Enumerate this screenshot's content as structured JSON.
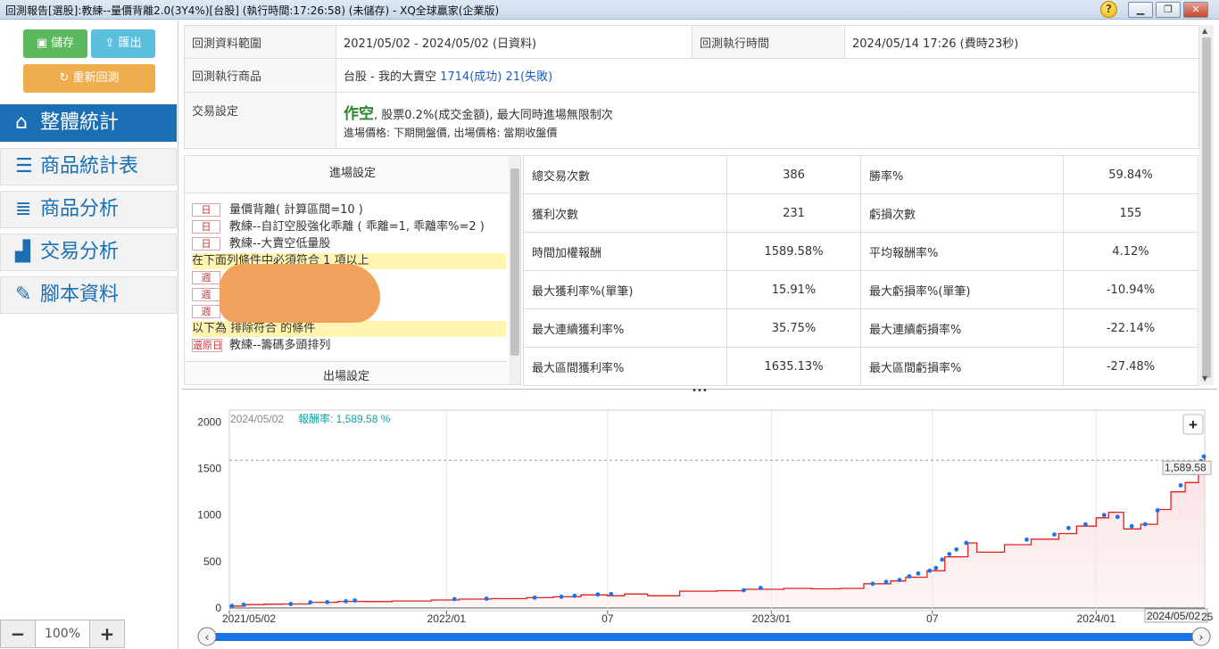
{
  "window": {
    "title": "回測報告[選股]:教練--量價背離2.0(3Y4%)[台股] (執行時間:17:26:58) (未儲存) - XQ全球贏家(企業版)",
    "help": "?",
    "min": "▁",
    "max": "❐",
    "close": "✕"
  },
  "toolbar": {
    "save": "儲存",
    "export": "匯出",
    "rerun": "重新回測"
  },
  "nav": [
    {
      "label": "整體統計",
      "icon": "home-icon"
    },
    {
      "label": "商品統計表",
      "icon": "list-icon"
    },
    {
      "label": "商品分析",
      "icon": "bullet-list-icon"
    },
    {
      "label": "交易分析",
      "icon": "bar-chart-icon"
    },
    {
      "label": "腳本資料",
      "icon": "pencil-icon"
    }
  ],
  "zoom": {
    "minus": "−",
    "value": "100%",
    "plus": "+"
  },
  "info": {
    "range_label": "回測資料範圍",
    "range_value": "2021/05/02 - 2024/05/02 (日資料)",
    "time_label": "回測執行時間",
    "time_value": "2024/05/14 17:26 (費時23秒)",
    "product_label": "回測執行商品",
    "product_prefix": "台股 - 我的大賣空",
    "product_success": "1714(成功)",
    "product_fail": "21(失敗)",
    "trade_label": "交易設定",
    "trade_mode": "作空",
    "trade_desc": ", 股票0.2%(成交金額), 最大同時進場無限制次",
    "trade_price": "進場價格: 下期開盤價, 出場價格: 當期收盤價"
  },
  "entry": {
    "header": "進場設定",
    "rows": [
      {
        "tag": "日",
        "text": "量價背離( 計算區間=10 )"
      },
      {
        "tag": "日",
        "text": "教練--自訂空股強化乖離 ( 乖離=1, 乖離率%=2 )"
      },
      {
        "tag": "日",
        "text": "教練--大賣空低量股"
      }
    ],
    "must_text": "在下面列條件中必須符合 1 項以上",
    "week_tags": [
      "週",
      "週",
      "週"
    ],
    "exclude_text": "以下為 排除符合 的條件",
    "restore_tag": "還原日",
    "restore_text": "教練--籌碼多頭排列",
    "footer": "出場設定"
  },
  "stats": [
    {
      "l1": "總交易次數",
      "v1": "386",
      "l2": "勝率%",
      "v2": "59.84%"
    },
    {
      "l1": "獲利次數",
      "v1": "231",
      "l2": "虧損次數",
      "v2": "155"
    },
    {
      "l1": "時間加權報酬",
      "v1": "1589.58%",
      "l2": "平均報酬率%",
      "v2": "4.12%"
    },
    {
      "l1": "最大獲利率%(單筆)",
      "v1": "15.91%",
      "l2": "最大虧損率%(單筆)",
      "v2": "-10.94%"
    },
    {
      "l1": "最大連續獲利率%",
      "v1": "35.75%",
      "l2": "最大連續虧損率%",
      "v2": "-22.14%"
    },
    {
      "l1": "最大區間獲利率%",
      "v1": "1635.13%",
      "l2": "最大區間虧損率%",
      "v2": "-27.48%"
    }
  ],
  "splitter": "•••",
  "colors": {
    "accent": "#1a6fb5",
    "save": "#5cb85c",
    "export": "#5bc0de",
    "rerun": "#f0ad4e",
    "line": "#e02020",
    "dot": "#1a73e8"
  },
  "chart_data": {
    "type": "area",
    "legend_date": "2024/05/02",
    "legend_label": "報酬率: 1,589.58 %",
    "last_value_label": "1,589.58",
    "cursor_date_label": "2024/05/02",
    "edge_label": "25",
    "zoom_button": "+",
    "yticks": [
      0,
      500,
      1000,
      1500,
      2000
    ],
    "ylim": [
      -30,
      2130
    ],
    "xlim": [
      "2021-05-02",
      "2024-05-02"
    ],
    "xticks": [
      {
        "date": "2021-05-02",
        "label": "2021/05/02"
      },
      {
        "date": "2022-01-01",
        "label": "2022/01"
      },
      {
        "date": "2022-07-01",
        "label": "07"
      },
      {
        "date": "2023-01-01",
        "label": "2023/01"
      },
      {
        "date": "2023-07-01",
        "label": "07"
      },
      {
        "date": "2024-01-01",
        "label": "2024/01"
      }
    ],
    "points": [
      [
        "2021-05-02",
        20
      ],
      [
        "2021-05-20",
        35
      ],
      [
        "2021-06-10",
        40
      ],
      [
        "2021-07-01",
        42
      ],
      [
        "2021-08-01",
        60
      ],
      [
        "2021-09-01",
        70
      ],
      [
        "2021-10-01",
        68
      ],
      [
        "2021-11-01",
        75
      ],
      [
        "2021-12-15",
        85
      ],
      [
        "2022-01-15",
        95
      ],
      [
        "2022-02-20",
        100
      ],
      [
        "2022-04-01",
        110
      ],
      [
        "2022-05-01",
        120
      ],
      [
        "2022-06-01",
        140
      ],
      [
        "2022-07-01",
        130
      ],
      [
        "2022-07-20",
        150
      ],
      [
        "2022-08-15",
        130
      ],
      [
        "2022-09-20",
        180
      ],
      [
        "2022-11-01",
        185
      ],
      [
        "2022-12-01",
        200
      ],
      [
        "2023-01-15",
        210
      ],
      [
        "2023-02-15",
        205
      ],
      [
        "2023-03-20",
        210
      ],
      [
        "2023-04-15",
        260
      ],
      [
        "2023-05-15",
        290
      ],
      [
        "2023-06-01",
        330
      ],
      [
        "2023-06-25",
        400
      ],
      [
        "2023-07-15",
        550
      ],
      [
        "2023-08-10",
        700
      ],
      [
        "2023-08-20",
        600
      ],
      [
        "2023-09-20",
        680
      ],
      [
        "2023-10-20",
        740
      ],
      [
        "2023-11-20",
        800
      ],
      [
        "2023-12-10",
        880
      ],
      [
        "2024-01-01",
        970
      ],
      [
        "2024-01-15",
        1030
      ],
      [
        "2024-02-01",
        850
      ],
      [
        "2024-02-20",
        900
      ],
      [
        "2024-03-10",
        1060
      ],
      [
        "2024-03-25",
        1250
      ],
      [
        "2024-04-10",
        1350
      ],
      [
        "2024-04-25",
        1500
      ],
      [
        "2024-05-02",
        1650
      ]
    ],
    "dots": [
      [
        "2021-05-05",
        22
      ],
      [
        "2021-05-18",
        34
      ],
      [
        "2021-07-10",
        42
      ],
      [
        "2021-08-01",
        60
      ],
      [
        "2021-08-20",
        62
      ],
      [
        "2021-09-10",
        72
      ],
      [
        "2021-09-20",
        80
      ],
      [
        "2022-01-10",
        95
      ],
      [
        "2022-02-15",
        100
      ],
      [
        "2022-04-10",
        110
      ],
      [
        "2022-05-10",
        120
      ],
      [
        "2022-05-25",
        130
      ],
      [
        "2022-06-20",
        145
      ],
      [
        "2022-07-05",
        150
      ],
      [
        "2022-12-01",
        190
      ],
      [
        "2022-12-20",
        215
      ],
      [
        "2023-04-25",
        260
      ],
      [
        "2023-05-10",
        280
      ],
      [
        "2023-05-25",
        300
      ],
      [
        "2023-06-05",
        340
      ],
      [
        "2023-06-15",
        370
      ],
      [
        "2023-06-28",
        400
      ],
      [
        "2023-07-05",
        430
      ],
      [
        "2023-07-12",
        520
      ],
      [
        "2023-07-20",
        580
      ],
      [
        "2023-07-28",
        630
      ],
      [
        "2023-08-08",
        700
      ],
      [
        "2023-10-15",
        735
      ],
      [
        "2023-11-15",
        790
      ],
      [
        "2023-12-01",
        860
      ],
      [
        "2023-12-20",
        900
      ],
      [
        "2024-01-10",
        1000
      ],
      [
        "2024-01-25",
        980
      ],
      [
        "2024-02-10",
        880
      ],
      [
        "2024-02-25",
        900
      ],
      [
        "2024-03-10",
        1050
      ],
      [
        "2024-04-05",
        1320
      ],
      [
        "2024-04-20",
        1450
      ],
      [
        "2024-04-28",
        1580
      ],
      [
        "2024-05-01",
        1630
      ]
    ]
  }
}
